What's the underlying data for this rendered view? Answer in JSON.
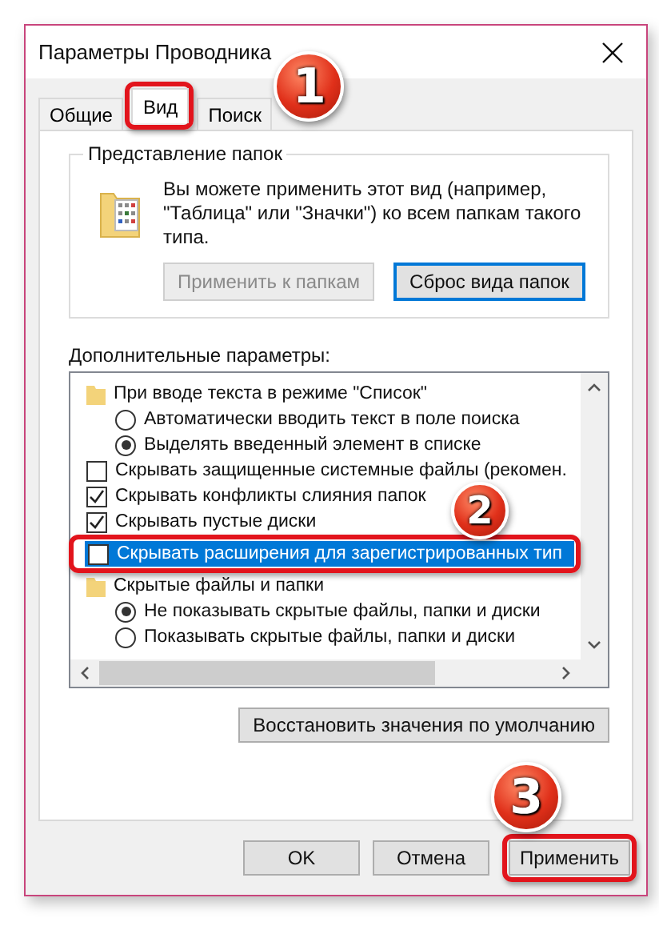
{
  "window": {
    "title": "Параметры Проводника"
  },
  "tabs": [
    {
      "label": "Общие",
      "selected": false
    },
    {
      "label": "Вид",
      "selected": true,
      "callout": "1"
    },
    {
      "label": "Поиск",
      "selected": false
    }
  ],
  "folder_views": {
    "title": "Представление папок",
    "description": "Вы можете применить этот вид (например, \"Таблица\" или \"Значки\") ко всем папкам такого типа.",
    "buttons": [
      {
        "label": "Применить к папкам",
        "disabled": true,
        "focused": false
      },
      {
        "label": "Сброс вида папок",
        "disabled": false,
        "focused": true
      }
    ]
  },
  "advanced": {
    "label": "Дополнительные параметры:",
    "items": [
      {
        "kind": "folder",
        "label": "При вводе текста в режиме \"Список\"",
        "selected": false,
        "children": [
          {
            "kind": "radio",
            "label": "Автоматически вводить текст в поле поиска",
            "checked": false,
            "selected": false
          },
          {
            "kind": "radio",
            "label": "Выделять введенный элемент в списке",
            "checked": true,
            "selected": false
          }
        ]
      },
      {
        "kind": "checkbox",
        "label": "Скрывать защищенные системные файлы (рекомен.",
        "checked": false,
        "selected": false
      },
      {
        "kind": "checkbox",
        "label": "Скрывать конфликты слияния папок",
        "checked": true,
        "selected": false
      },
      {
        "kind": "checkbox",
        "label": "Скрывать пустые диски",
        "checked": true,
        "selected": false
      },
      {
        "kind": "checkbox",
        "label": "Скрывать расширения для зарегистрированных тип",
        "checked": false,
        "selected": true,
        "callout": "2"
      },
      {
        "kind": "folder",
        "label": "Скрытые файлы и папки",
        "selected": false,
        "children": [
          {
            "kind": "radio",
            "label": "Не показывать скрытые файлы, папки и диски",
            "checked": true,
            "selected": false
          },
          {
            "kind": "radio",
            "label": "Показывать скрытые файлы, папки и диски",
            "checked": false,
            "selected": false
          }
        ]
      }
    ],
    "restore_button": "Восстановить значения по умолчанию"
  },
  "buttons": [
    {
      "label": "OK"
    },
    {
      "label": "Отмена"
    },
    {
      "label": "Применить",
      "callout": "3"
    }
  ]
}
